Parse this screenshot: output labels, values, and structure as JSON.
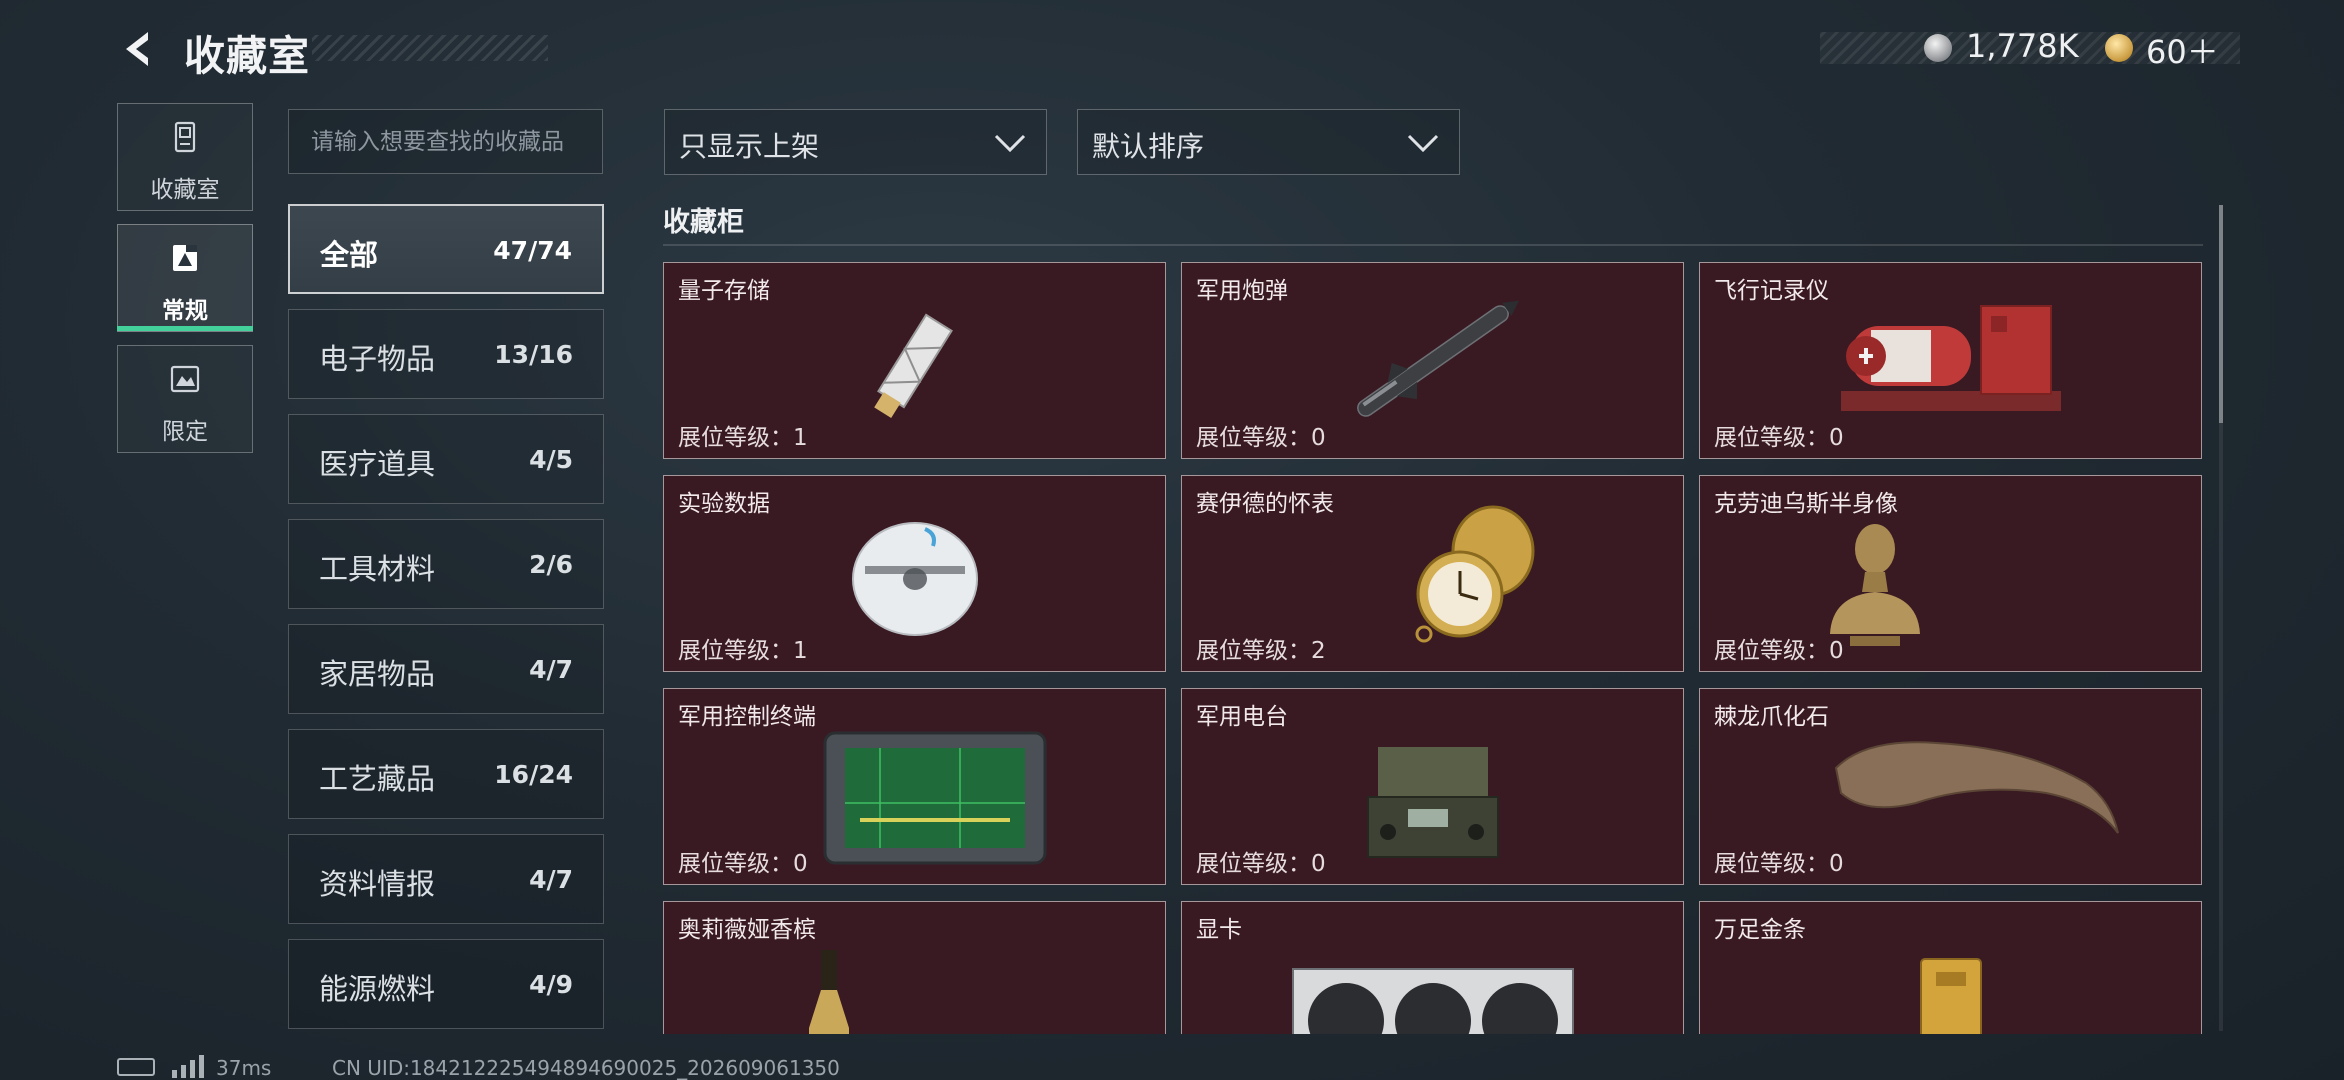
{
  "header": {
    "title": "收藏室",
    "currencies": [
      {
        "icon": "silver-coin-icon",
        "value": "1,778K"
      },
      {
        "icon": "gold-coin-icon",
        "value": "60＋"
      }
    ]
  },
  "nav": [
    {
      "label": "收藏室",
      "icon": "collection-room-icon",
      "active": false
    },
    {
      "label": "常规",
      "icon": "regular-icon",
      "active": true
    },
    {
      "label": "限定",
      "icon": "limited-icon",
      "active": false
    }
  ],
  "search": {
    "placeholder": "请输入想要查找的收藏品",
    "value": ""
  },
  "categories": [
    {
      "name": "全部",
      "count": "47/74",
      "active": true
    },
    {
      "name": "电子物品",
      "count": "13/16"
    },
    {
      "name": "医疗道具",
      "count": "4/5"
    },
    {
      "name": "工具材料",
      "count": "2/6"
    },
    {
      "name": "家居物品",
      "count": "4/7"
    },
    {
      "name": "工艺藏品",
      "count": "16/24"
    },
    {
      "name": "资料情报",
      "count": "4/7"
    },
    {
      "name": "能源燃料",
      "count": "4/9"
    }
  ],
  "filters": {
    "show_filter": "只显示上架",
    "sort": "默认排序"
  },
  "section": {
    "title": "收藏柜"
  },
  "level_label": "展位等级：",
  "items": [
    {
      "name": "量子存储",
      "level": "1",
      "icon": "usb-drive-icon"
    },
    {
      "name": "军用炮弹",
      "level": "0",
      "icon": "missile-icon"
    },
    {
      "name": "飞行记录仪",
      "level": "0",
      "icon": "flight-recorder-icon"
    },
    {
      "name": "实验数据",
      "level": "1",
      "icon": "disc-icon"
    },
    {
      "name": "赛伊德的怀表",
      "level": "2",
      "icon": "pocket-watch-icon"
    },
    {
      "name": "克劳迪乌斯半身像",
      "level": "0",
      "icon": "bust-icon"
    },
    {
      "name": "军用控制终端",
      "level": "0",
      "icon": "control-terminal-icon"
    },
    {
      "name": "军用电台",
      "level": "0",
      "icon": "radio-icon"
    },
    {
      "name": "棘龙爪化石",
      "level": "0",
      "icon": "claw-fossil-icon"
    },
    {
      "name": "奥莉薇娅香槟",
      "level": "",
      "icon": "champagne-icon"
    },
    {
      "name": "显卡",
      "level": "",
      "icon": "graphics-card-icon"
    },
    {
      "name": "万足金条",
      "level": "",
      "icon": "gold-bar-icon"
    }
  ],
  "footer": {
    "ping": "37ms",
    "uid": "CN UID:18421222549489469​0025_202609061350"
  }
}
